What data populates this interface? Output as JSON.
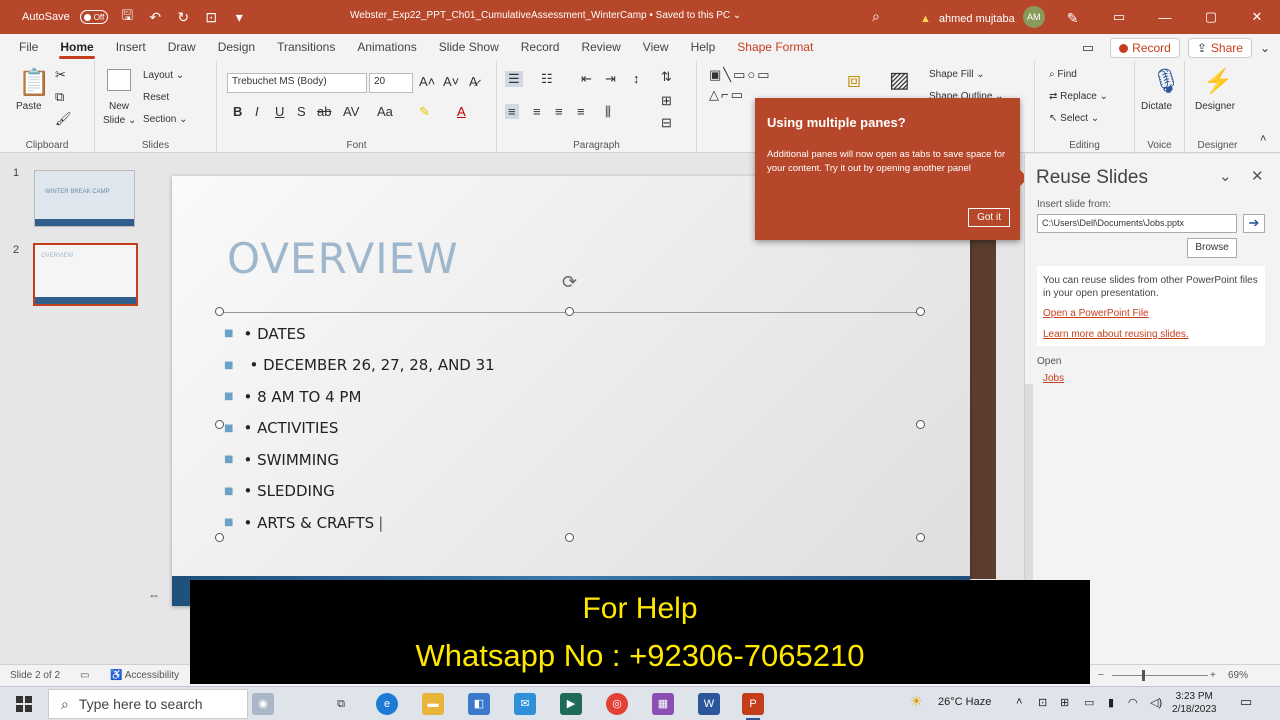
{
  "titlebar": {
    "autosave_label": "AutoSave",
    "autosave_state": "Off",
    "doc_title": "Webster_Exp22_PPT_Ch01_CumulativeAssessment_WinterCamp • Saved to this PC ⌄",
    "user_name": "ahmed mujtaba",
    "user_initials": "AM"
  },
  "tabs": {
    "items": [
      "File",
      "Home",
      "Insert",
      "Draw",
      "Design",
      "Transitions",
      "Animations",
      "Slide Show",
      "Record",
      "Review",
      "View",
      "Help",
      "Shape Format"
    ],
    "active": "Home",
    "record_button": "Record",
    "share_button": "Share"
  },
  "ribbon": {
    "clipboard": {
      "label": "Clipboard",
      "paste": "Paste"
    },
    "slides": {
      "label": "Slides",
      "new_slide": "New",
      "new_slide2": "Slide ⌄",
      "layout": "Layout ⌄",
      "reset": "Reset",
      "section": "Section ⌄"
    },
    "font": {
      "label": "Font",
      "family": "Trebuchet MS (Body)",
      "size": "20"
    },
    "paragraph": {
      "label": "Paragraph"
    },
    "drawing": {
      "shape_fill": "Shape Fill ⌄",
      "shape_outline": "Shape Outline ⌄"
    },
    "editing": {
      "label": "Editing",
      "find": "Find",
      "replace": "Replace ⌄",
      "select": "Select ⌄"
    },
    "voice": {
      "label": "Voice",
      "dictate": "Dictate"
    },
    "designer": {
      "label": "Designer",
      "designer": "Designer"
    }
  },
  "thumbnails": {
    "items": [
      {
        "number": "1",
        "caption": "WINTER BREAK CAMP"
      },
      {
        "number": "2",
        "caption": "OVERVIEW"
      }
    ],
    "selected": 2
  },
  "slide": {
    "title": "OVERVIEW",
    "bullets": [
      {
        "text": "• DATES",
        "level": 1
      },
      {
        "text": "• DECEMBER 26, 27, 28, AND 31",
        "level": 2
      },
      {
        "text": "• 8 AM TO 4 PM",
        "level": 1
      },
      {
        "text": "• ACTIVITIES",
        "level": 1
      },
      {
        "text": "• SWIMMING",
        "level": 1
      },
      {
        "text": "• SLEDDING",
        "level": 1
      },
      {
        "text": "• ARTS & CRAFTS",
        "level": 1
      }
    ]
  },
  "tooltip": {
    "title": "Using multiple panes?",
    "body": "Additional panes will now open as tabs to save space for your content. Try it out by opening another panel",
    "button": "Got it"
  },
  "reuse_pane": {
    "title": "Reuse Slides",
    "insert_label": "Insert slide from:",
    "path": "C:\\Users\\Dell\\Documents\\Jobs.pptx",
    "browse": "Browse",
    "info": "You can reuse slides from other PowerPoint files in your open presentation.",
    "link_open": "Open a PowerPoint File",
    "link_learn": "Learn more about reusing slides.",
    "open_label": "Open",
    "open_file": "Jobs"
  },
  "statusbar": {
    "slide_count": "Slide 2 of 2",
    "accessibility": "Accessibility",
    "zoom": "69%"
  },
  "banner": {
    "line1": "For Help",
    "line2": "Whatsapp No : +92306-7065210"
  },
  "taskbar": {
    "search_placeholder": "Type here to search",
    "weather": "26°C  Haze",
    "time": "3:23 PM",
    "date": "2/18/2023"
  },
  "colors": {
    "accent": "#b7472a",
    "title_blue": "#9fb7cc",
    "banner_text": "#ffe800"
  }
}
